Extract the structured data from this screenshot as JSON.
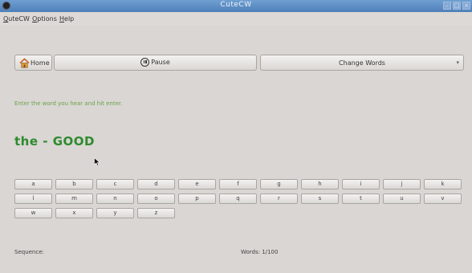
{
  "window": {
    "title": "CuteCW",
    "controls": [
      "minimize",
      "maximize",
      "close"
    ]
  },
  "menubar": {
    "items": [
      {
        "mnemonic": "Q",
        "rest": "uteCW"
      },
      {
        "mnemonic": "O",
        "rest": "ptions"
      },
      {
        "mnemonic": "H",
        "rest": "elp"
      }
    ]
  },
  "toolbar": {
    "home_label": "Home",
    "pause_label": "Pause",
    "change_words_label": "Change Words"
  },
  "main": {
    "instruction": "Enter the word you hear and hit enter.",
    "result": "the - GOOD"
  },
  "keyboard": {
    "keys": [
      "a",
      "b",
      "c",
      "d",
      "e",
      "f",
      "g",
      "h",
      "i",
      "j",
      "k",
      "l",
      "m",
      "n",
      "o",
      "p",
      "q",
      "r",
      "s",
      "t",
      "u",
      "v",
      "w",
      "x",
      "y",
      "z"
    ]
  },
  "status": {
    "sequence_label": "Sequence:",
    "words_label": "Words: 1/100"
  }
}
